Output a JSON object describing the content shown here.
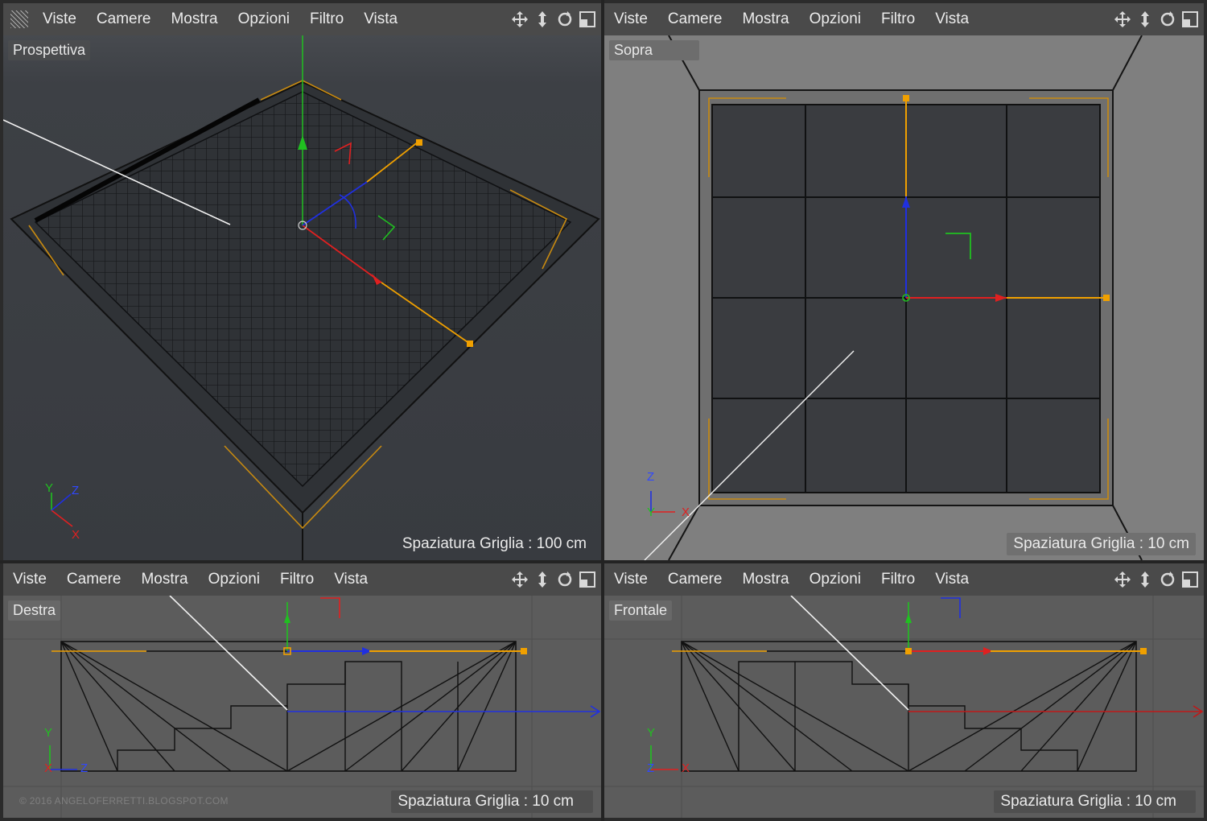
{
  "menu": [
    "Viste",
    "Camere",
    "Mostra",
    "Opzioni",
    "Filtro",
    "Vista"
  ],
  "tool_icons": [
    "move-icon",
    "zoom-icon",
    "rotate-icon",
    "maximize-icon"
  ],
  "viewports": {
    "perspective": {
      "label": "Prospettiva",
      "grid_spacing": "Spaziatura Griglia : 100 cm"
    },
    "top": {
      "label": "Sopra",
      "grid_spacing": "Spaziatura Griglia : 10 cm"
    },
    "right": {
      "label": "Destra",
      "grid_spacing": "Spaziatura Griglia : 10 cm"
    },
    "front": {
      "label": "Frontale",
      "grid_spacing": "Spaziatura Griglia : 10 cm"
    }
  },
  "axes": {
    "x": "X",
    "y": "Y",
    "z": "Z"
  },
  "watermark": "© 2016 ANGELOFERRETTI.BLOGSPOT.COM",
  "colors": {
    "x_axis": "#e02020",
    "y_axis": "#20c020",
    "z_axis": "#2030e0",
    "handle": "#f0a000"
  }
}
